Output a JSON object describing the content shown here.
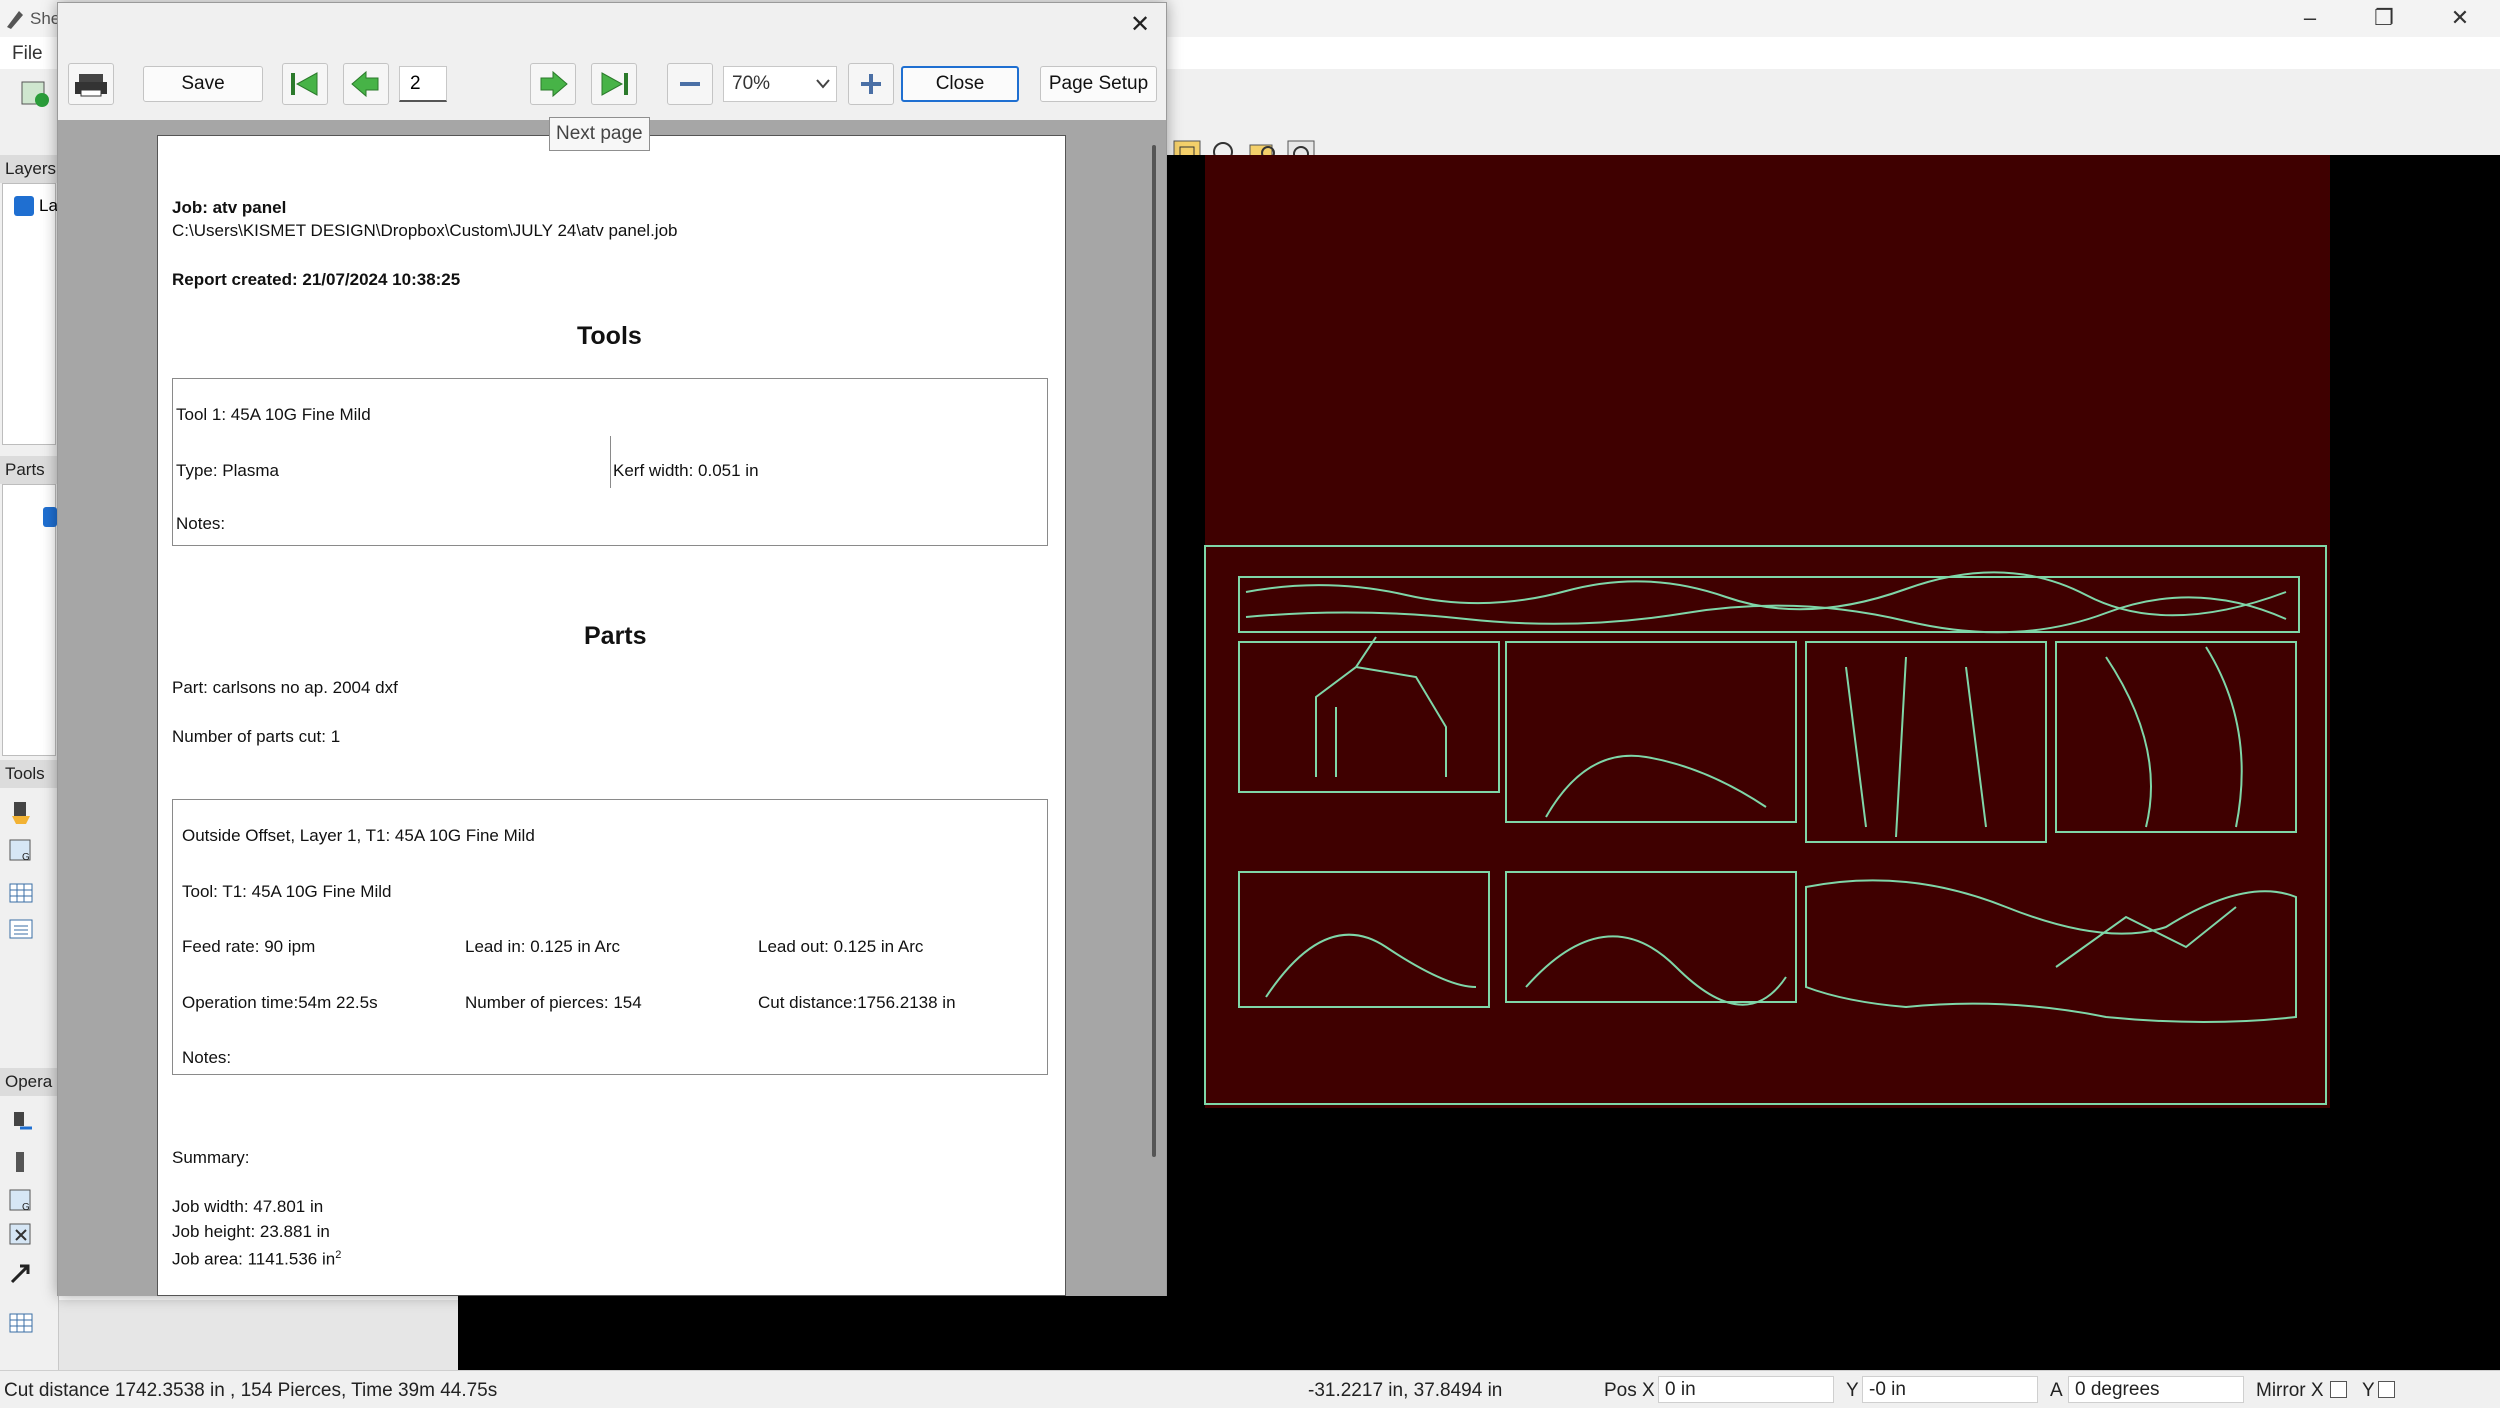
{
  "app": {
    "title_fragment": "She",
    "menu_file": "File"
  },
  "left_panel": {
    "layers_header": "Layers",
    "layer_item": "La",
    "parts_header": "Parts",
    "tools_header": "Tools",
    "operations_header": "Opera"
  },
  "dialog": {
    "save": "Save",
    "page_number": "2",
    "zoom": "70%",
    "close": "Close",
    "page_setup": "Page Setup",
    "tooltip": "Next page"
  },
  "report": {
    "job_title": "Job: atv panel",
    "job_path": "C:\\Users\\KISMET DESIGN\\Dropbox\\Custom\\JULY 24\\atv panel.job",
    "report_created": "Report created: 21/07/2024 10:38:25",
    "tools_heading": "Tools",
    "tool_name": "Tool 1: 45A 10G Fine Mild",
    "tool_type": "Type: Plasma",
    "kerf_width": "Kerf width: 0.051 in",
    "tool_notes": "Notes:",
    "parts_heading": "Parts",
    "part_name": "Part: carlsons no ap. 2004 dxf",
    "parts_cut": "Number of parts cut: 1",
    "operation": "Outside Offset, Layer 1, T1: 45A 10G Fine Mild",
    "op_tool": "Tool: T1: 45A 10G Fine Mild",
    "feed_rate": "Feed rate: 90 ipm",
    "lead_in": "Lead in: 0.125 in Arc",
    "lead_out": "Lead out: 0.125 in Arc",
    "op_time": "Operation time:54m 22.5s",
    "pierces": "Number of pierces: 154",
    "cut_distance": "Cut distance:1756.2138 in",
    "op_notes": "Notes:",
    "summary": "Summary:",
    "job_width": "Job width: 47.801 in",
    "job_height": "Job height: 23.881 in",
    "job_area": "Job area: 1141.536 in",
    "job_area_sup": "2"
  },
  "statusbar": {
    "cut_summary": "Cut distance 1742.3538 in , 154 Pierces, Time 39m 44.75s",
    "coords": "-31.2217 in, 37.8494 in",
    "pos_x_label": "Pos X",
    "pos_x_value": "0 in",
    "y_label": "Y",
    "y_value": "-0 in",
    "a_label": "A",
    "a_value": "0 degrees",
    "mirror_label": "Mirror X",
    "mirror_y_label": "Y"
  },
  "colors": {
    "sheet": "#3f0000",
    "cut_path": "#7fd6a8",
    "canvas": "#000000",
    "accent": "#1f6fd1"
  }
}
